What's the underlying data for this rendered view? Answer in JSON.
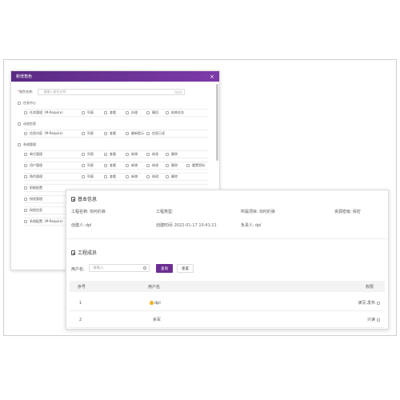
{
  "dialog": {
    "title": "新增角色",
    "close_glyph": "×",
    "name_label": "角色名称:",
    "name_placeholder": "请输入角色名称",
    "name_counter": "0/20",
    "groups": [
      {
        "label": "任务中心",
        "subs": [
          {
            "items": [
              "任务管理（M-Require）",
              "列表",
              "查看",
              "办理",
              "撤回",
              "结束任务"
            ]
          }
        ]
      },
      {
        "label": "动态信息",
        "subs": [
          {
            "items": [
              "信息内容（M-Require）",
              "列表",
              "查看",
              "最新提示",
              "信息已读"
            ]
          }
        ]
      },
      {
        "label": "系统管理",
        "subs": [
          {
            "items": [
              "单位管理",
              "列表",
              "查看",
              "新增",
              "修改",
              "删除"
            ]
          },
          {
            "items": [
              "用户管理",
              "列表",
              "查看",
              "新增",
              "修改",
              "删除",
              "重置密码"
            ]
          },
          {
            "items": [
              "角色管理",
              "列表",
              "查看",
              "新增",
              "修改",
              "删除"
            ]
          },
          {
            "items": [
              "职能配置"
            ]
          },
          {
            "items": [
              "授权管理"
            ]
          },
          {
            "items": [
              "授权信息"
            ]
          },
          {
            "items": [
              "系统配置（M-Require）"
            ]
          }
        ]
      }
    ]
  },
  "panel": {
    "basic_title": "基本信息",
    "project_name_label": "工程名称:",
    "project_name_value": "淘何的弹",
    "project_type_label": "工程类型:",
    "project_type_value": "",
    "belong_project_label": "所属项目:",
    "belong_project_value": "淘何的弹",
    "secret_label": "资源密级:",
    "secret_value": "保密",
    "creator_label": "创建人:",
    "creator_value": "dpl",
    "created_time_label": "创建时间:",
    "created_time_value": "2022-01-17 10:41:21",
    "owner_label": "负责人:",
    "owner_value": "dpl",
    "members_title": "工程成员",
    "user_label": "用户名:",
    "user_placeholder": "请输入",
    "search_btn": "查询",
    "reset_btn": "重置",
    "table": {
      "headers": [
        "序号",
        "用户名",
        "权限"
      ],
      "rows": [
        {
          "index": "1",
          "user": "dpl",
          "owner": true,
          "perm": "读写,发布"
        },
        {
          "index": "2",
          "user": "余军",
          "owner": false,
          "perm": "只读"
        }
      ]
    }
  }
}
